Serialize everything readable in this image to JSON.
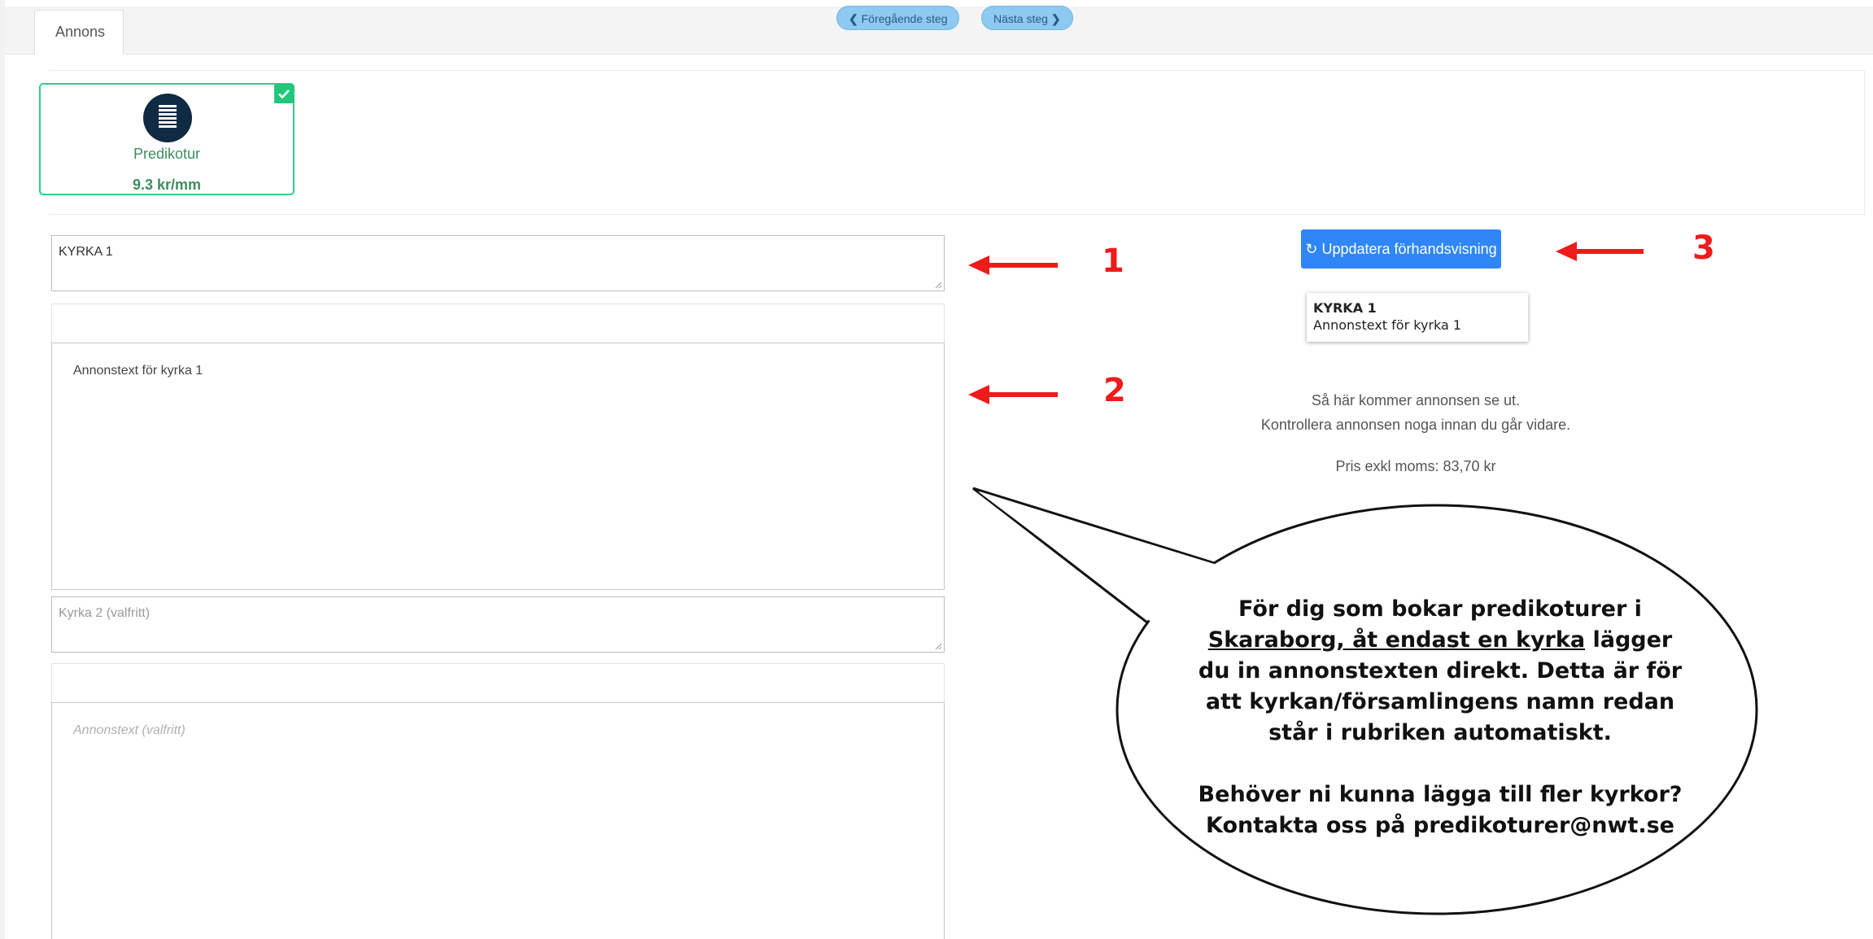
{
  "tabs": {
    "active": "Annons"
  },
  "nav": {
    "prev": "Föregående steg",
    "next": "Nästa steg"
  },
  "product": {
    "name": "Predikotur",
    "price": "9.3 kr/mm"
  },
  "form": {
    "church1_value": "KYRKA 1",
    "adtext1_value": "Annonstext för kyrka 1",
    "church2_placeholder": "Kyrka 2 (valfritt)",
    "adtext2_placeholder": "Annonstext (valfritt)"
  },
  "preview": {
    "button_label": "Uppdatera förhandsvisning",
    "title": "KYRKA 1",
    "body": "Annonstext för kyrka 1",
    "info_line1": "Så här kommer annonsen se ut.",
    "info_line2": "Kontrollera annonsen noga innan du går vidare.",
    "price_text": "Pris exkl moms: 83,70 kr"
  },
  "annotations": {
    "n1": "1",
    "n2": "2",
    "n3": "3",
    "arrow_color": "#ee1b1b",
    "bubble": {
      "p1_a": "För dig som bokar predikoturer i",
      "p1_underlined": "Skaraborg, åt endast en kyrka",
      "p1_b": "lägger du in annonstexten direkt. Detta är för att kyrkan/församlingens namn redan står i rubriken automatiskt.",
      "p2_line1": "Behöver ni kunna lägga till fler kyrkor?",
      "p2_line2": "Kontakta oss på predikoturer@nwt.se"
    }
  },
  "colors": {
    "accent": "#2f86f6",
    "success": "#21c77a",
    "nav_pill": "#8ec9f2"
  }
}
